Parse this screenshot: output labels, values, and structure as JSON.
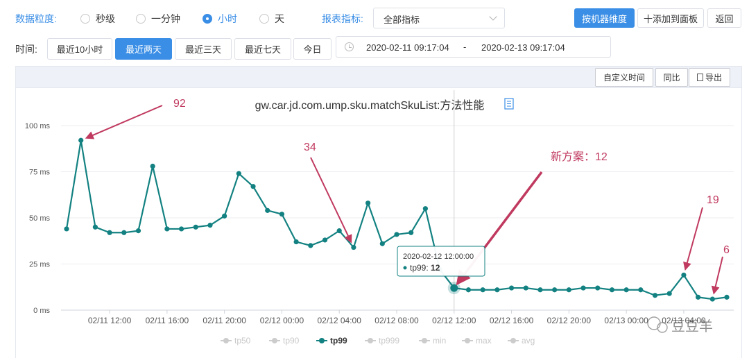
{
  "filters": {
    "granularity_label": "数据粒度:",
    "granularity_options": [
      "秒级",
      "一分钟",
      "小时",
      "天"
    ],
    "granularity_selected": "小时",
    "metric_label": "报表指标:",
    "metric_value": "全部指标",
    "by_machine_label": "按机器维度",
    "add_to_panel_label": "十添加到面板",
    "back_label": "返回"
  },
  "time": {
    "label": "时间:",
    "presets": [
      "最近10小时",
      "最近两天",
      "最近三天",
      "最近七天",
      "今日"
    ],
    "selected": "最近两天",
    "start": "2020-02-11 09:17:04",
    "separator": "-",
    "end": "2020-02-13 09:17:04"
  },
  "panel": {
    "custom_time_label": "自定义时间",
    "compare_label": "同比",
    "export_label": "导出"
  },
  "colors": {
    "accent": "#3a8ee6",
    "series": "#138181",
    "annotation": "#c0395f"
  },
  "chart_data": {
    "type": "line",
    "title": "gw.car.jd.com.ump.sku.matchSkuList:方法性能",
    "y_tick_labels": [
      "0 ms",
      "25 ms",
      "50 ms",
      "75 ms",
      "100 ms"
    ],
    "y_ticks": [
      0,
      25,
      50,
      75,
      100
    ],
    "ylim": [
      0,
      100
    ],
    "x_tick_labels": [
      "02/11 12:00",
      "02/11 16:00",
      "02/11 20:00",
      "02/12 00:00",
      "02/12 04:00",
      "02/12 08:00",
      "02/12 12:00",
      "02/12 16:00",
      "02/12 20:00",
      "02/13 00:00",
      "02/13 04:00"
    ],
    "x_tick_hours": [
      3,
      7,
      11,
      15,
      19,
      23,
      27,
      31,
      35,
      39,
      43
    ],
    "x_hours_range": [
      0,
      46
    ],
    "grid": true,
    "legend": [
      "tp50",
      "tp90",
      "tp99",
      "tp999",
      "min",
      "max",
      "avg"
    ],
    "legend_active": "tp99",
    "legend_placement": "bottom",
    "series": [
      {
        "name": "tp99",
        "x_hours": [
          0,
          1,
          2,
          3,
          4,
          5,
          6,
          7,
          8,
          9,
          10,
          11,
          12,
          13,
          14,
          15,
          16,
          17,
          18,
          19,
          20,
          21,
          22,
          23,
          24,
          25,
          26,
          27,
          28,
          29,
          30,
          31,
          32,
          33,
          34,
          35,
          36,
          37,
          38,
          39,
          40,
          41,
          42,
          43,
          44,
          45,
          46
        ],
        "values": [
          44,
          92,
          45,
          42,
          42,
          43,
          78,
          44,
          44,
          45,
          46,
          51,
          74,
          67,
          54,
          52,
          37,
          35,
          38,
          43,
          34,
          58,
          36,
          41,
          42,
          55,
          22,
          12,
          11,
          11,
          11,
          12,
          12,
          11,
          11,
          11,
          12,
          12,
          11,
          11,
          11,
          8,
          9,
          19,
          7,
          6,
          7
        ]
      }
    ],
    "tooltip": {
      "time": "2020-02-12 12:00:00",
      "series": "tp99",
      "value": "12",
      "x_hour": 27
    },
    "annotations": [
      {
        "text": "92",
        "x_hour": 1,
        "value": 92
      },
      {
        "text": "34",
        "x_hour": 20,
        "value": 34
      },
      {
        "text": "新方案：12",
        "x_hour": 27,
        "value": 12
      },
      {
        "text": "19",
        "x_hour": 43,
        "value": 19
      },
      {
        "text": "6",
        "x_hour": 45,
        "value": 6
      }
    ]
  },
  "watermark": "豆豆羊"
}
